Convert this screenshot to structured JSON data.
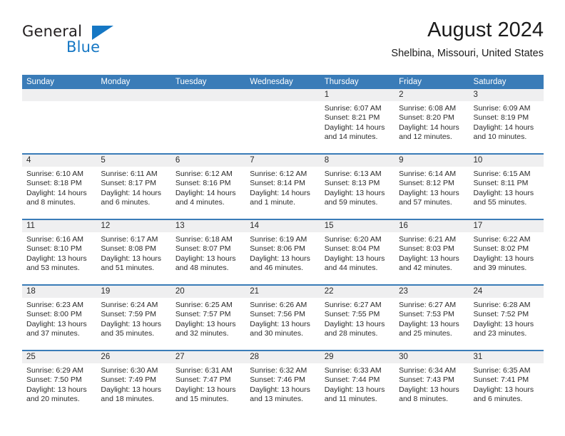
{
  "brand": {
    "name_part1": "General",
    "name_part2": "Blue"
  },
  "header": {
    "title": "August 2024",
    "subtitle": "Shelbina, Missouri, United States"
  },
  "weekdays": [
    "Sunday",
    "Monday",
    "Tuesday",
    "Wednesday",
    "Thursday",
    "Friday",
    "Saturday"
  ],
  "colors": {
    "header_blue": "#3a7cb8",
    "brand_blue": "#1577c4",
    "date_band": "#efeff0"
  },
  "labels": {
    "sunrise_prefix": "Sunrise: ",
    "sunset_prefix": "Sunset: ",
    "daylight_prefix": "Daylight: "
  },
  "weeks": [
    [
      {
        "day": "",
        "empty": true
      },
      {
        "day": "",
        "empty": true
      },
      {
        "day": "",
        "empty": true
      },
      {
        "day": "",
        "empty": true
      },
      {
        "day": "1",
        "sunrise": "Sunrise: 6:07 AM",
        "sunset": "Sunset: 8:21 PM",
        "daylight": "Daylight: 14 hours and 14 minutes."
      },
      {
        "day": "2",
        "sunrise": "Sunrise: 6:08 AM",
        "sunset": "Sunset: 8:20 PM",
        "daylight": "Daylight: 14 hours and 12 minutes."
      },
      {
        "day": "3",
        "sunrise": "Sunrise: 6:09 AM",
        "sunset": "Sunset: 8:19 PM",
        "daylight": "Daylight: 14 hours and 10 minutes."
      }
    ],
    [
      {
        "day": "4",
        "sunrise": "Sunrise: 6:10 AM",
        "sunset": "Sunset: 8:18 PM",
        "daylight": "Daylight: 14 hours and 8 minutes."
      },
      {
        "day": "5",
        "sunrise": "Sunrise: 6:11 AM",
        "sunset": "Sunset: 8:17 PM",
        "daylight": "Daylight: 14 hours and 6 minutes."
      },
      {
        "day": "6",
        "sunrise": "Sunrise: 6:12 AM",
        "sunset": "Sunset: 8:16 PM",
        "daylight": "Daylight: 14 hours and 4 minutes."
      },
      {
        "day": "7",
        "sunrise": "Sunrise: 6:12 AM",
        "sunset": "Sunset: 8:14 PM",
        "daylight": "Daylight: 14 hours and 1 minute."
      },
      {
        "day": "8",
        "sunrise": "Sunrise: 6:13 AM",
        "sunset": "Sunset: 8:13 PM",
        "daylight": "Daylight: 13 hours and 59 minutes."
      },
      {
        "day": "9",
        "sunrise": "Sunrise: 6:14 AM",
        "sunset": "Sunset: 8:12 PM",
        "daylight": "Daylight: 13 hours and 57 minutes."
      },
      {
        "day": "10",
        "sunrise": "Sunrise: 6:15 AM",
        "sunset": "Sunset: 8:11 PM",
        "daylight": "Daylight: 13 hours and 55 minutes."
      }
    ],
    [
      {
        "day": "11",
        "sunrise": "Sunrise: 6:16 AM",
        "sunset": "Sunset: 8:10 PM",
        "daylight": "Daylight: 13 hours and 53 minutes."
      },
      {
        "day": "12",
        "sunrise": "Sunrise: 6:17 AM",
        "sunset": "Sunset: 8:08 PM",
        "daylight": "Daylight: 13 hours and 51 minutes."
      },
      {
        "day": "13",
        "sunrise": "Sunrise: 6:18 AM",
        "sunset": "Sunset: 8:07 PM",
        "daylight": "Daylight: 13 hours and 48 minutes."
      },
      {
        "day": "14",
        "sunrise": "Sunrise: 6:19 AM",
        "sunset": "Sunset: 8:06 PM",
        "daylight": "Daylight: 13 hours and 46 minutes."
      },
      {
        "day": "15",
        "sunrise": "Sunrise: 6:20 AM",
        "sunset": "Sunset: 8:04 PM",
        "daylight": "Daylight: 13 hours and 44 minutes."
      },
      {
        "day": "16",
        "sunrise": "Sunrise: 6:21 AM",
        "sunset": "Sunset: 8:03 PM",
        "daylight": "Daylight: 13 hours and 42 minutes."
      },
      {
        "day": "17",
        "sunrise": "Sunrise: 6:22 AM",
        "sunset": "Sunset: 8:02 PM",
        "daylight": "Daylight: 13 hours and 39 minutes."
      }
    ],
    [
      {
        "day": "18",
        "sunrise": "Sunrise: 6:23 AM",
        "sunset": "Sunset: 8:00 PM",
        "daylight": "Daylight: 13 hours and 37 minutes."
      },
      {
        "day": "19",
        "sunrise": "Sunrise: 6:24 AM",
        "sunset": "Sunset: 7:59 PM",
        "daylight": "Daylight: 13 hours and 35 minutes."
      },
      {
        "day": "20",
        "sunrise": "Sunrise: 6:25 AM",
        "sunset": "Sunset: 7:57 PM",
        "daylight": "Daylight: 13 hours and 32 minutes."
      },
      {
        "day": "21",
        "sunrise": "Sunrise: 6:26 AM",
        "sunset": "Sunset: 7:56 PM",
        "daylight": "Daylight: 13 hours and 30 minutes."
      },
      {
        "day": "22",
        "sunrise": "Sunrise: 6:27 AM",
        "sunset": "Sunset: 7:55 PM",
        "daylight": "Daylight: 13 hours and 28 minutes."
      },
      {
        "day": "23",
        "sunrise": "Sunrise: 6:27 AM",
        "sunset": "Sunset: 7:53 PM",
        "daylight": "Daylight: 13 hours and 25 minutes."
      },
      {
        "day": "24",
        "sunrise": "Sunrise: 6:28 AM",
        "sunset": "Sunset: 7:52 PM",
        "daylight": "Daylight: 13 hours and 23 minutes."
      }
    ],
    [
      {
        "day": "25",
        "sunrise": "Sunrise: 6:29 AM",
        "sunset": "Sunset: 7:50 PM",
        "daylight": "Daylight: 13 hours and 20 minutes."
      },
      {
        "day": "26",
        "sunrise": "Sunrise: 6:30 AM",
        "sunset": "Sunset: 7:49 PM",
        "daylight": "Daylight: 13 hours and 18 minutes."
      },
      {
        "day": "27",
        "sunrise": "Sunrise: 6:31 AM",
        "sunset": "Sunset: 7:47 PM",
        "daylight": "Daylight: 13 hours and 15 minutes."
      },
      {
        "day": "28",
        "sunrise": "Sunrise: 6:32 AM",
        "sunset": "Sunset: 7:46 PM",
        "daylight": "Daylight: 13 hours and 13 minutes."
      },
      {
        "day": "29",
        "sunrise": "Sunrise: 6:33 AM",
        "sunset": "Sunset: 7:44 PM",
        "daylight": "Daylight: 13 hours and 11 minutes."
      },
      {
        "day": "30",
        "sunrise": "Sunrise: 6:34 AM",
        "sunset": "Sunset: 7:43 PM",
        "daylight": "Daylight: 13 hours and 8 minutes."
      },
      {
        "day": "31",
        "sunrise": "Sunrise: 6:35 AM",
        "sunset": "Sunset: 7:41 PM",
        "daylight": "Daylight: 13 hours and 6 minutes."
      }
    ]
  ]
}
